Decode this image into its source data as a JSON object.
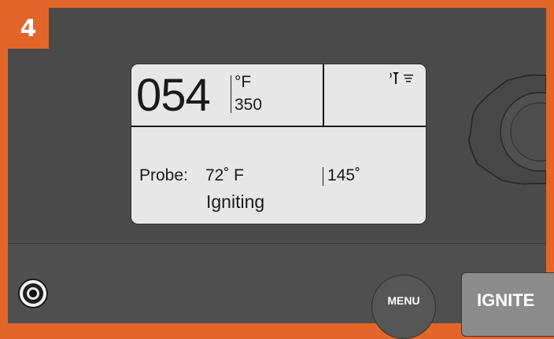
{
  "step": {
    "number": "4"
  },
  "display": {
    "current_temp": "054",
    "unit": "°F",
    "setpoint": "350",
    "probe_label": "Probe:",
    "probe_temp": "72˚ F",
    "probe_target": "145˚",
    "status": "Igniting",
    "icons": [
      "probe-icon",
      "menu-lines-icon"
    ]
  },
  "controls": {
    "menu_label": "MENU",
    "ignite_label": "IGNITE"
  },
  "colors": {
    "accent": "#e2662a",
    "panel": "#4a4a4a",
    "lcd": "#e7e7e7"
  }
}
